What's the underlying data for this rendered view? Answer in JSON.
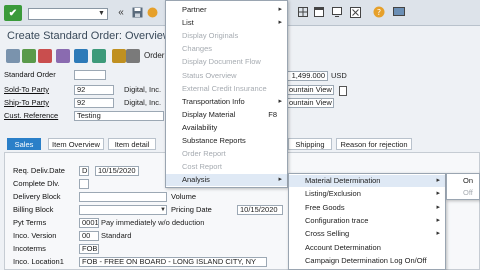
{
  "toolbar": {
    "ok_symbol": "✔",
    "back_symbol": "«",
    "nav_symbols": [
      "«",
      "▢",
      "⊙",
      "⊗"
    ]
  },
  "window_title": "Create Standard Order: Overview",
  "app_toolbar": {
    "order_fragment": "Order"
  },
  "header": {
    "order_type_label": "Standard Order",
    "sold_to_label": "Sold-To Party",
    "sold_to_value": "92",
    "sold_to_name": "Digital, Inc.",
    "ship_to_label": "Ship-To Party",
    "ship_to_value": "92",
    "ship_to_name": "Digital, Inc.",
    "cust_ref_label": "Cust. Reference",
    "cust_ref_value": "Testing",
    "net_value": "1,499.000",
    "currency": "USD",
    "sold_to_city": "ountain View .",
    "ship_to_city": "ountain View ."
  },
  "tabs": [
    {
      "label": "Sales",
      "active": true
    },
    {
      "label": "Item Overview",
      "active": false
    },
    {
      "label": "Item detail",
      "active": false
    },
    {
      "label": "Shipping",
      "active": false
    },
    {
      "label": "Reason for rejection",
      "active": false
    }
  ],
  "sales": {
    "req_deliv_label": "Req. Deliv.Date",
    "req_deliv_unit": "D",
    "req_deliv_date": "10/15/2020",
    "complete_dlv_label": "Complete Dlv.",
    "delivery_block_label": "Delivery Block",
    "billing_block_label": "Billing Block",
    "pyt_terms_label": "Pyt Terms",
    "pyt_terms_code": "0001",
    "pyt_terms_text": "Pay immediately w/o deduction",
    "inco_version_label": "Inco. Version",
    "inco_version_code": "00",
    "inco_version_text": "Standard",
    "incoterms_label": "Incoterms",
    "incoterms_value": "FOB",
    "inco_location_label": "Inco. Location1",
    "inco_location_value": "FOB - FREE ON BOARD - LONG ISLAND CITY, NY",
    "volume_label": "Volume",
    "pricing_date_label": "Pricing Date",
    "pricing_date_value": "10/15/2020"
  },
  "menu1": [
    {
      "label": "Partner",
      "arrow": true,
      "disabled": false
    },
    {
      "label": "List",
      "arrow": true,
      "disabled": false
    },
    {
      "label": "Display Originals",
      "arrow": false,
      "disabled": true
    },
    {
      "label": "Changes",
      "arrow": false,
      "disabled": true
    },
    {
      "label": "Display Document Flow",
      "arrow": false,
      "disabled": true
    },
    {
      "label": "Status Overview",
      "arrow": false,
      "disabled": true
    },
    {
      "label": "External Credit Insurance",
      "arrow": false,
      "disabled": true
    },
    {
      "label": "Transportation Info",
      "arrow": true,
      "disabled": false
    },
    {
      "label": "Display Material",
      "accel": "F8",
      "arrow": false,
      "disabled": false
    },
    {
      "label": "Availability",
      "arrow": false,
      "disabled": false
    },
    {
      "label": "Substance Reports",
      "arrow": false,
      "disabled": false
    },
    {
      "label": "Order Report",
      "arrow": false,
      "disabled": true
    },
    {
      "label": "Cost Report",
      "arrow": false,
      "disabled": true
    },
    {
      "label": "Analysis",
      "arrow": true,
      "disabled": false,
      "highlighted": true
    }
  ],
  "menu2": [
    {
      "label": "Material Determination",
      "arrow": true,
      "highlighted": true
    },
    {
      "label": "Listing/Exclusion",
      "arrow": true
    },
    {
      "label": "Free Goods",
      "arrow": true
    },
    {
      "label": "Configuration trace",
      "arrow": true
    },
    {
      "label": "Cross Selling",
      "arrow": true
    },
    {
      "label": "Account Determination",
      "arrow": false
    },
    {
      "label": "Campaign Determination Log On/Off",
      "arrow": false
    }
  ],
  "menu3": [
    {
      "label": "On",
      "disabled": false,
      "checked": true
    },
    {
      "label": "Off",
      "disabled": true,
      "checked": false
    }
  ]
}
